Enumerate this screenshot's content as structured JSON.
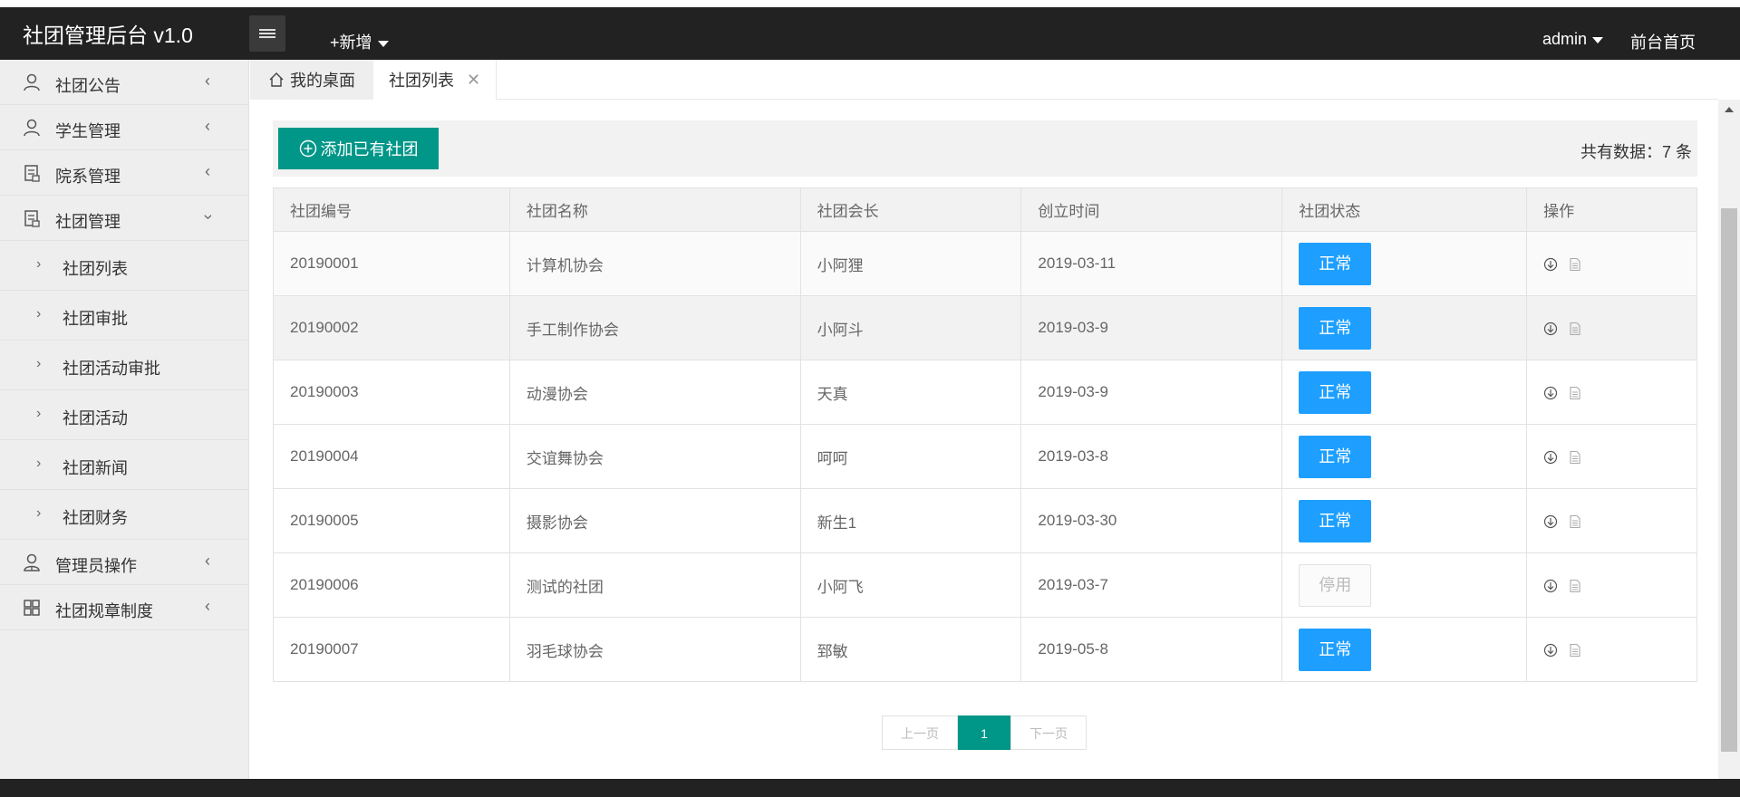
{
  "header": {
    "title": "社团管理后台 v1.0",
    "add_menu": "+新增",
    "user": "admin",
    "front_link": "前台首页"
  },
  "sidebar": {
    "items": [
      {
        "label": "社团公告",
        "icon": "user-icon"
      },
      {
        "label": "学生管理",
        "icon": "user-icon"
      },
      {
        "label": "院系管理",
        "icon": "document-icon"
      },
      {
        "label": "社团管理",
        "icon": "document-icon"
      }
    ],
    "sub_items": [
      "社团列表",
      "社团审批",
      "社团活动审批",
      "社团活动",
      "社团新闻",
      "社团财务"
    ],
    "bottom_items": [
      {
        "label": "管理员操作",
        "icon": "admin-icon"
      },
      {
        "label": "社团规章制度",
        "icon": "grid-icon"
      }
    ]
  },
  "tabs": {
    "home": "我的桌面",
    "active": "社团列表"
  },
  "toolbar": {
    "add_button": "添加已有社团",
    "total": "共有数据：7 条"
  },
  "table": {
    "columns": [
      "社团编号",
      "社团名称",
      "社团会长",
      "创立时间",
      "社团状态",
      "操作"
    ],
    "rows": [
      {
        "id": "20190001",
        "name": "计算机协会",
        "leader": "小阿狸",
        "date": "2019-03-11",
        "status": "正常"
      },
      {
        "id": "20190002",
        "name": "手工制作协会",
        "leader": "小阿斗",
        "date": "2019-03-9",
        "status": "正常"
      },
      {
        "id": "20190003",
        "name": "动漫协会",
        "leader": "天真",
        "date": "2019-03-9",
        "status": "正常"
      },
      {
        "id": "20190004",
        "name": "交谊舞协会",
        "leader": "呵呵",
        "date": "2019-03-8",
        "status": "正常"
      },
      {
        "id": "20190005",
        "name": "摄影协会",
        "leader": "新生1",
        "date": "2019-03-30",
        "status": "正常"
      },
      {
        "id": "20190006",
        "name": "测试的社团",
        "leader": "小阿飞",
        "date": "2019-03-7",
        "status": "停用"
      },
      {
        "id": "20190007",
        "name": "羽毛球协会",
        "leader": "郅敏",
        "date": "2019-05-8",
        "status": "正常"
      }
    ]
  },
  "pager": {
    "prev": "上一页",
    "current": "1",
    "next": "下一页"
  },
  "colors": {
    "primary": "#009688",
    "status_normal": "#1e9fff",
    "topbar": "#222222"
  }
}
